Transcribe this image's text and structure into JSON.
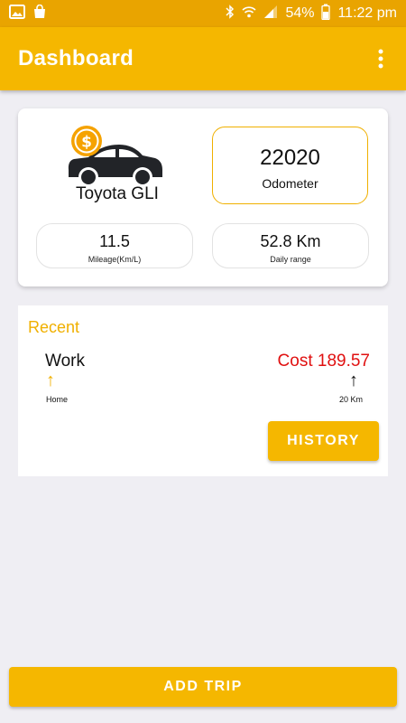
{
  "status_bar": {
    "battery": "54%",
    "time": "11:22 pm",
    "icons": [
      "image-icon",
      "bag-icon",
      "bluetooth-icon",
      "wifi-icon",
      "signal-icon",
      "battery-icon"
    ]
  },
  "app_bar": {
    "title": "Dashboard",
    "menu_icon": "more-vert-icon"
  },
  "car": {
    "name": "Toyota GLI",
    "icon": "car-coin-icon",
    "odometer_value": "22020",
    "odometer_label": "Odometer",
    "mileage_value": "11.5",
    "mileage_label": "Mileage(Km/L)",
    "range_value": "52.8 Km",
    "range_label": "Daily range"
  },
  "recent": {
    "title": "Recent",
    "to": "Work",
    "from": "Home",
    "cost": "Cost 189.57",
    "distance": "20 Km",
    "arrow": "↑",
    "history_button": "HISTORY"
  },
  "add_trip_button": "ADD TRIP",
  "colors": {
    "primary": "#f5b700",
    "status_bar": "#e9a400",
    "cost": "#e01010",
    "background": "#efeef3"
  }
}
